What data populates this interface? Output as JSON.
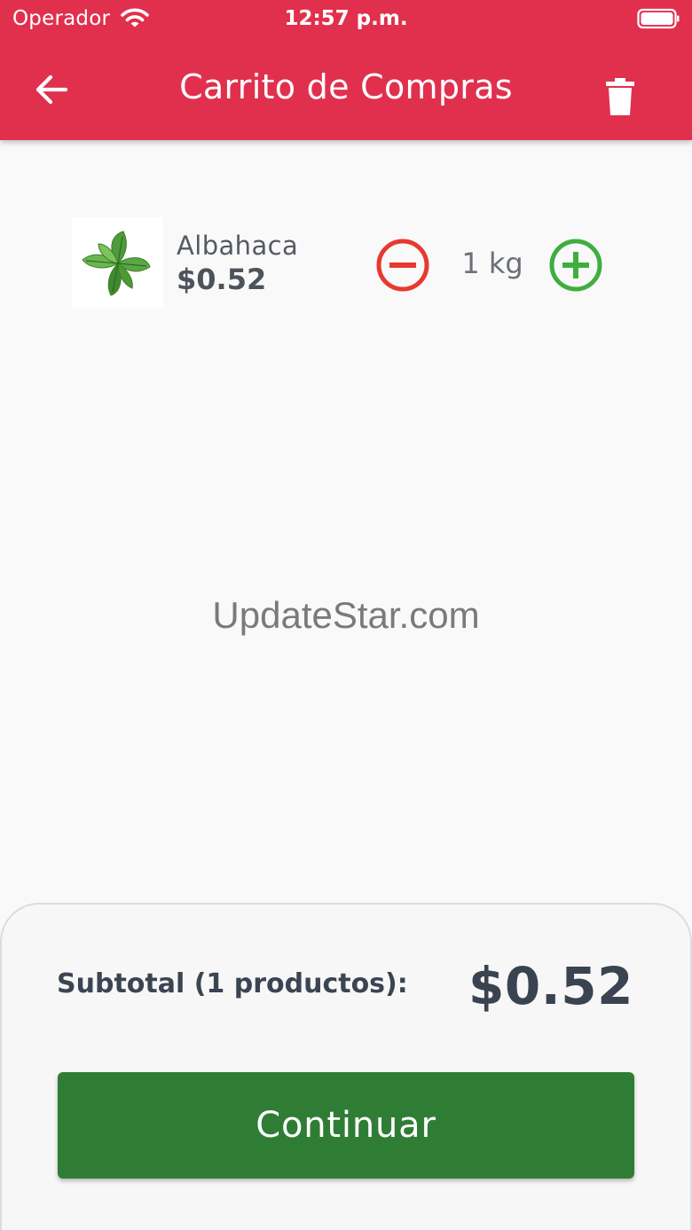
{
  "status_bar": {
    "carrier": "Operador",
    "time": "12:57 p.m."
  },
  "header": {
    "title": "Carrito de Compras",
    "back_icon": "arrow-left-icon",
    "delete_icon": "trash-icon"
  },
  "cart": {
    "items": [
      {
        "name": "Albahaca",
        "price": "$0.52",
        "quantity": "1 kg",
        "image_icon": "basil-image"
      }
    ]
  },
  "watermark": "UpdateStar.com",
  "summary": {
    "subtotal_label": "Subtotal (1 productos):",
    "subtotal_value": "$0.52",
    "continue_label": "Continuar"
  },
  "colors": {
    "primary": "#e0304e",
    "accept": "#2f7d34",
    "decrement": "#e8392f",
    "increment": "#3fae3f"
  }
}
